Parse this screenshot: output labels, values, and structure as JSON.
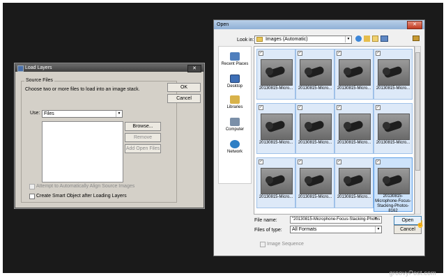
{
  "load_layers": {
    "title": "Load Layers",
    "group_title": "Source Files",
    "instructions": "Choose two or more files to load into an image stack.",
    "use_label": "Use:",
    "use_value": "Files",
    "ok_label": "OK",
    "cancel_label": "Cancel",
    "browse_label": "Browse...",
    "remove_label": "Remove",
    "add_open_files_label": "Add Open Files",
    "align_label": "Attempt to Automatically Align Source Images",
    "smart_object_label": "Create Smart Object after Loading Layers"
  },
  "open_dialog": {
    "title": "Open",
    "look_in_label": "Look in:",
    "look_in_value": "Images (Automatic)",
    "places": [
      {
        "label": "Recent Places",
        "icon": "recent-places-icon"
      },
      {
        "label": "Desktop",
        "icon": "desktop-icon"
      },
      {
        "label": "Libraries",
        "icon": "libraries-icon"
      },
      {
        "label": "Computer",
        "icon": "computer-icon"
      },
      {
        "label": "Network",
        "icon": "network-icon"
      }
    ],
    "files": [
      {
        "label": "20130815-Micro..."
      },
      {
        "label": "20130815-Micro..."
      },
      {
        "label": "20130815-Micro..."
      },
      {
        "label": "20130815-Micro..."
      },
      {
        "label": "20130815-Micro..."
      },
      {
        "label": "20130815-Micro..."
      },
      {
        "label": "20130815-Micro..."
      },
      {
        "label": "20130815-Micro..."
      },
      {
        "label": "20130815-Micro..."
      },
      {
        "label": "20130815-Micro..."
      },
      {
        "label": "20130815-Micro..."
      },
      {
        "label": "20130815-Microphone-Focus-Stacking-Photos-8162"
      }
    ],
    "file_name_label": "File name:",
    "file_name_value": "\"20130815-Microphone-Focus-Stacking-Photos",
    "files_of_type_label": "Files of type:",
    "files_of_type_value": "All Formats",
    "open_label": "Open",
    "cancel_label": "Cancel",
    "image_sequence_label": "Image Sequence"
  },
  "watermark": "groovyPost.com"
}
